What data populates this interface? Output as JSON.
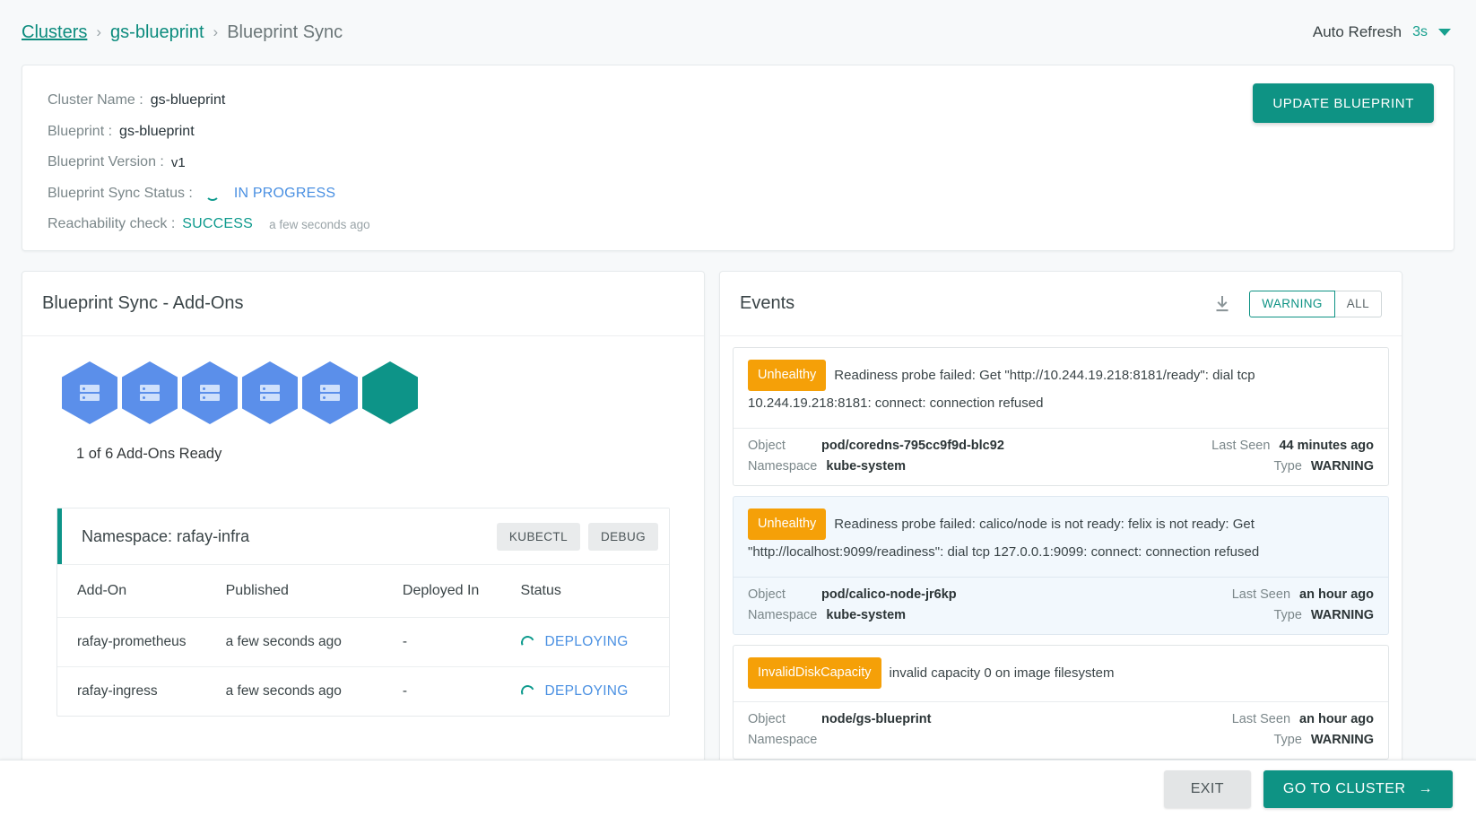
{
  "breadcrumb": {
    "root": "Clusters",
    "cluster": "gs-blueprint",
    "current": "Blueprint Sync",
    "separator": "›"
  },
  "auto_refresh": {
    "label": "Auto Refresh",
    "value": "3s"
  },
  "cluster_info": {
    "cluster_name_label": "Cluster Name :",
    "cluster_name_value": "gs-blueprint",
    "blueprint_label": "Blueprint :",
    "blueprint_value": "gs-blueprint",
    "version_label": "Blueprint Version :",
    "version_value": "v1",
    "sync_status_label": "Blueprint Sync Status :",
    "sync_status_value": "IN PROGRESS",
    "reachability_label": "Reachability check :",
    "reachability_value": "SUCCESS",
    "reachability_time": "a few seconds ago",
    "update_button": "UPDATE BLUEPRINT"
  },
  "addons_panel": {
    "title": "Blueprint Sync - Add-Ons",
    "hexagons": [
      {
        "state": "pending"
      },
      {
        "state": "pending"
      },
      {
        "state": "pending"
      },
      {
        "state": "pending"
      },
      {
        "state": "pending"
      },
      {
        "state": "ready"
      }
    ],
    "ready_text": "1 of 6 Add-Ons Ready",
    "namespace_title": "Namespace: rafay-infra",
    "kubectl_button": "KUBECTL",
    "debug_button": "DEBUG",
    "columns": [
      "Add-On",
      "Published",
      "Deployed In",
      "Status"
    ],
    "rows": [
      {
        "addon": "rafay-prometheus",
        "published": "a few seconds ago",
        "deployed_in": "-",
        "status": "DEPLOYING"
      },
      {
        "addon": "rafay-ingress",
        "published": "a few seconds ago",
        "deployed_in": "-",
        "status": "DEPLOYING"
      }
    ]
  },
  "events_panel": {
    "title": "Events",
    "download_icon": "download-icon",
    "filter_warning": "WARNING",
    "filter_all": "ALL",
    "meta_labels": {
      "object": "Object",
      "namespace": "Namespace",
      "last_seen": "Last Seen",
      "type": "Type"
    },
    "events": [
      {
        "badge": "Unhealthy",
        "message": "Readiness probe failed: Get \"http://10.244.19.218:8181/ready\": dial tcp 10.244.19.218:8181: connect: connection refused",
        "object": "pod/coredns-795cc9f9d-blc92",
        "namespace": "kube-system",
        "last_seen": "44 minutes ago",
        "type": "WARNING",
        "highlighted": false
      },
      {
        "badge": "Unhealthy",
        "message": "Readiness probe failed: calico/node is not ready: felix is not ready: Get \"http://localhost:9099/readiness\": dial tcp 127.0.0.1:9099: connect: connection refused",
        "object": "pod/calico-node-jr6kp",
        "namespace": "kube-system",
        "last_seen": "an hour ago",
        "type": "WARNING",
        "highlighted": true
      },
      {
        "badge": "InvalidDiskCapacity",
        "message": "invalid capacity 0 on image filesystem",
        "object": "node/gs-blueprint",
        "namespace": "",
        "last_seen": "an hour ago",
        "type": "WARNING",
        "highlighted": false
      }
    ]
  },
  "footer": {
    "exit_button": "EXIT",
    "go_button": "GO TO CLUSTER",
    "go_arrow": "→"
  },
  "colors": {
    "accent": "#0e9384",
    "warning": "#f5a008",
    "info": "#4a90e2",
    "hex_pending": "#5b8fea",
    "hex_ready": "#0d9488"
  }
}
